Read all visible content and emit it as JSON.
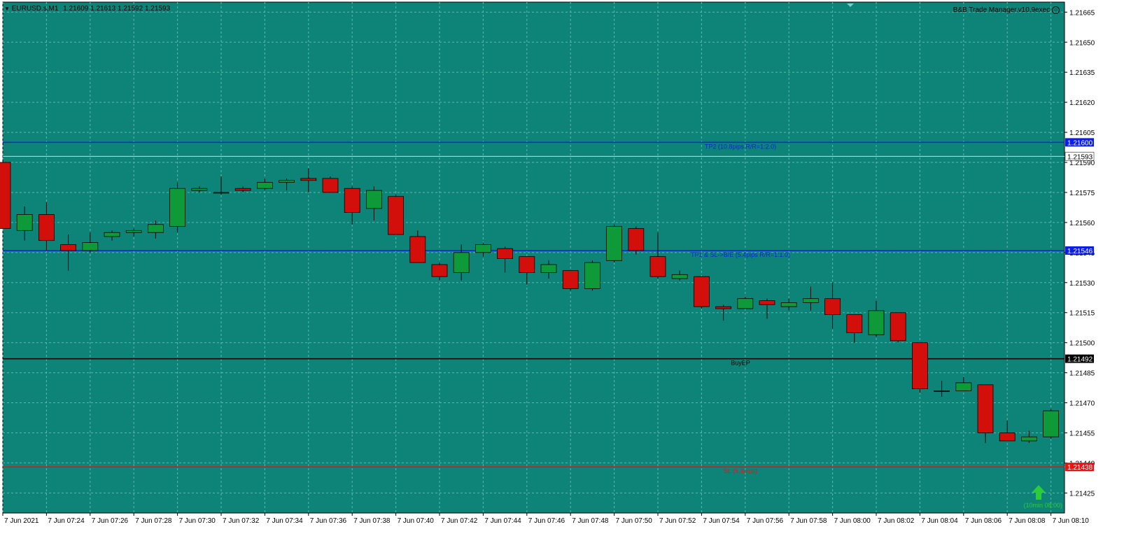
{
  "header": {
    "symbol": "EURUSD.s,M1",
    "ohlc": "1.21609 1.21613 1.21592 1.21593",
    "ea_name": "B&B Trade Manager.v10.9exec",
    "ea_icon": "smiley-icon"
  },
  "colors": {
    "background": "#0e8478",
    "grid": "#5db7ad",
    "bull": "#0f9a3a",
    "bear": "#d20f0a",
    "tp_line": "#0a1ee6",
    "entry_line": "#000000",
    "sl_line": "#e61414",
    "bid_line": "#c8dcdc",
    "arrow": "#2ccc3c"
  },
  "arrow_label": "(10min 08:00)",
  "chart_data": {
    "type": "candlestick",
    "timeframe": "M1",
    "ylim": [
      1.21415,
      1.2167
    ],
    "yticks": [
      "1.21665",
      "1.21650",
      "1.21635",
      "1.21620",
      "1.21605",
      "1.21590",
      "1.21575",
      "1.21560",
      "1.21545",
      "1.21530",
      "1.21515",
      "1.21500",
      "1.21485",
      "1.21470",
      "1.21455",
      "1.21440",
      "1.21425"
    ],
    "xtick_labels": [
      "7 Jun 2021",
      "7 Jun 07:24",
      "7 Jun 07:26",
      "7 Jun 07:28",
      "7 Jun 07:30",
      "7 Jun 07:32",
      "7 Jun 07:34",
      "7 Jun 07:36",
      "7 Jun 07:38",
      "7 Jun 07:40",
      "7 Jun 07:42",
      "7 Jun 07:44",
      "7 Jun 07:46",
      "7 Jun 07:48",
      "7 Jun 07:50",
      "7 Jun 07:52",
      "7 Jun 07:54",
      "7 Jun 07:56",
      "7 Jun 07:58",
      "7 Jun 08:00",
      "7 Jun 08:02",
      "7 Jun 08:04",
      "7 Jun 08:06",
      "7 Jun 08:08",
      "7 Jun 08:10"
    ],
    "candles": [
      {
        "o": 1.2159,
        "h": 1.21591,
        "l": 1.21557,
        "c": 1.21557
      },
      {
        "o": 1.21556,
        "h": 1.21568,
        "l": 1.21551,
        "c": 1.21564
      },
      {
        "o": 1.21564,
        "h": 1.2157,
        "l": 1.21546,
        "c": 1.21551
      },
      {
        "o": 1.21549,
        "h": 1.21554,
        "l": 1.21536,
        "c": 1.21546
      },
      {
        "o": 1.21546,
        "h": 1.21555,
        "l": 1.21545,
        "c": 1.2155
      },
      {
        "o": 1.21553,
        "h": 1.21556,
        "l": 1.21551,
        "c": 1.21555
      },
      {
        "o": 1.21555,
        "h": 1.21557,
        "l": 1.21553,
        "c": 1.21556
      },
      {
        "o": 1.21555,
        "h": 1.21561,
        "l": 1.21552,
        "c": 1.21559
      },
      {
        "o": 1.21558,
        "h": 1.2158,
        "l": 1.21555,
        "c": 1.21577
      },
      {
        "o": 1.21576,
        "h": 1.21578,
        "l": 1.21575,
        "c": 1.21577
      },
      {
        "o": 1.21575,
        "h": 1.21583,
        "l": 1.21574,
        "c": 1.21575
      },
      {
        "o": 1.21577,
        "h": 1.21578,
        "l": 1.21575,
        "c": 1.21576
      },
      {
        "o": 1.21577,
        "h": 1.21582,
        "l": 1.21576,
        "c": 1.2158
      },
      {
        "o": 1.2158,
        "h": 1.21582,
        "l": 1.21576,
        "c": 1.21581
      },
      {
        "o": 1.21582,
        "h": 1.21587,
        "l": 1.21575,
        "c": 1.21581
      },
      {
        "o": 1.21582,
        "h": 1.21583,
        "l": 1.21575,
        "c": 1.21575
      },
      {
        "o": 1.21577,
        "h": 1.21578,
        "l": 1.21559,
        "c": 1.21565
      },
      {
        "o": 1.21567,
        "h": 1.21578,
        "l": 1.21561,
        "c": 1.21576
      },
      {
        "o": 1.21573,
        "h": 1.21574,
        "l": 1.21554,
        "c": 1.21554
      },
      {
        "o": 1.21553,
        "h": 1.21556,
        "l": 1.2154,
        "c": 1.2154
      },
      {
        "o": 1.21539,
        "h": 1.2154,
        "l": 1.21531,
        "c": 1.21533
      },
      {
        "o": 1.21535,
        "h": 1.21549,
        "l": 1.21531,
        "c": 1.21545
      },
      {
        "o": 1.21545,
        "h": 1.2155,
        "l": 1.21543,
        "c": 1.21549
      },
      {
        "o": 1.21547,
        "h": 1.21548,
        "l": 1.21535,
        "c": 1.21542
      },
      {
        "o": 1.21543,
        "h": 1.21543,
        "l": 1.21529,
        "c": 1.21535
      },
      {
        "o": 1.21535,
        "h": 1.21541,
        "l": 1.21532,
        "c": 1.21539
      },
      {
        "o": 1.21536,
        "h": 1.21536,
        "l": 1.21526,
        "c": 1.21527
      },
      {
        "o": 1.21527,
        "h": 1.21541,
        "l": 1.21526,
        "c": 1.2154
      },
      {
        "o": 1.21541,
        "h": 1.21559,
        "l": 1.2154,
        "c": 1.21558
      },
      {
        "o": 1.21557,
        "h": 1.21558,
        "l": 1.21544,
        "c": 1.21546
      },
      {
        "o": 1.21543,
        "h": 1.21555,
        "l": 1.21532,
        "c": 1.21533
      },
      {
        "o": 1.21532,
        "h": 1.21536,
        "l": 1.21531,
        "c": 1.21534
      },
      {
        "o": 1.21533,
        "h": 1.21533,
        "l": 1.21517,
        "c": 1.21518
      },
      {
        "o": 1.21518,
        "h": 1.21519,
        "l": 1.21511,
        "c": 1.21517
      },
      {
        "o": 1.21517,
        "h": 1.21523,
        "l": 1.21517,
        "c": 1.21522
      },
      {
        "o": 1.21521,
        "h": 1.21522,
        "l": 1.21512,
        "c": 1.21519
      },
      {
        "o": 1.21518,
        "h": 1.21522,
        "l": 1.21516,
        "c": 1.2152
      },
      {
        "o": 1.2152,
        "h": 1.21528,
        "l": 1.21516,
        "c": 1.21522
      },
      {
        "o": 1.21522,
        "h": 1.2153,
        "l": 1.21507,
        "c": 1.21514
      },
      {
        "o": 1.21514,
        "h": 1.21514,
        "l": 1.215,
        "c": 1.21505
      },
      {
        "o": 1.21504,
        "h": 1.21521,
        "l": 1.21503,
        "c": 1.21516
      },
      {
        "o": 1.21515,
        "h": 1.21515,
        "l": 1.215,
        "c": 1.21501
      },
      {
        "o": 1.215,
        "h": 1.215,
        "l": 1.21475,
        "c": 1.21477
      },
      {
        "o": 1.21476,
        "h": 1.21481,
        "l": 1.21473,
        "c": 1.21476
      },
      {
        "o": 1.21476,
        "h": 1.21483,
        "l": 1.21476,
        "c": 1.2148
      },
      {
        "o": 1.21479,
        "h": 1.21479,
        "l": 1.2145,
        "c": 1.21455
      },
      {
        "o": 1.21455,
        "h": 1.21461,
        "l": 1.21451,
        "c": 1.21451
      },
      {
        "o": 1.21451,
        "h": 1.21456,
        "l": 1.2145,
        "c": 1.21453
      },
      {
        "o": 1.21453,
        "h": 1.21467,
        "l": 1.21452,
        "c": 1.21466
      }
    ],
    "hlines": [
      {
        "price": 1.216,
        "price_label": "1.21600",
        "label": "TP2 (10.8pips R/R=1:2.0)",
        "color": "#0a1ee6"
      },
      {
        "price": 1.21546,
        "price_label": "1.21546",
        "label": "TP1 & SL->B/E (5.4pips R/R=1:1.0)",
        "color": "#0a1ee6"
      },
      {
        "price": 1.21492,
        "price_label": "1.21492",
        "label": "BuyEP",
        "color": "#000000"
      },
      {
        "price": 1.21438,
        "price_label": "1.21438",
        "label": "SL (5.4pips)",
        "color": "#e61414"
      }
    ],
    "bid": {
      "price": 1.21593,
      "price_label": "1.21593"
    }
  }
}
